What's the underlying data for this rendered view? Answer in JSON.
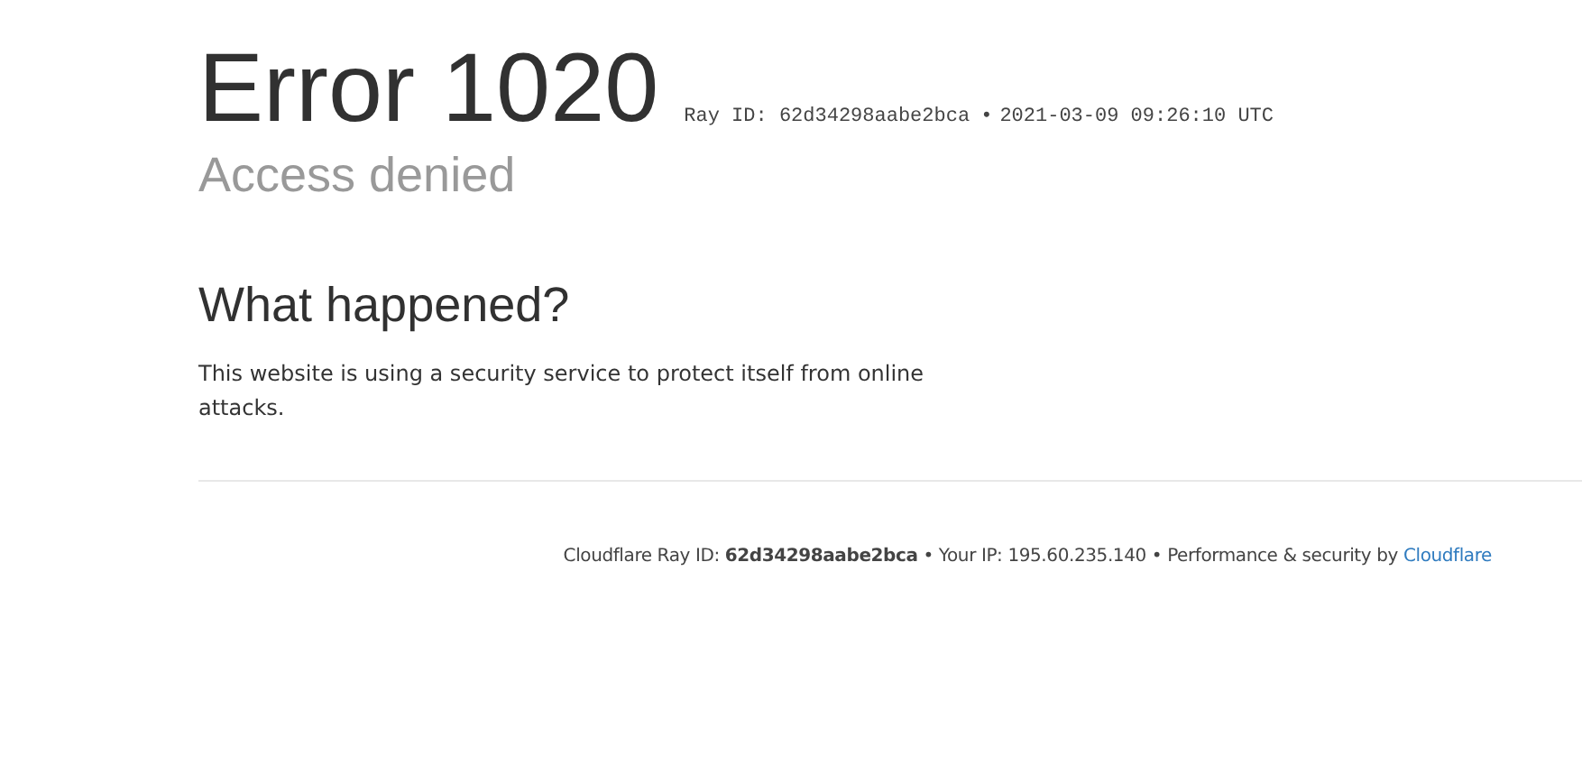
{
  "header": {
    "title": "Error 1020",
    "ray_id": "Ray ID: 62d34298aabe2bca",
    "separator": "•",
    "timestamp": "2021-03-09 09:26:10 UTC",
    "subtitle": "Access denied"
  },
  "section": {
    "heading": "What happened?",
    "text": "This website is using a security service to protect itself from online attacks."
  },
  "footer": {
    "text": "Cloudflare Ray ID: **62d34298aabe2bca** • Your IP: 195.60.235.140 • Performance & security by",
    "link": "Cloudflare"
  }
}
